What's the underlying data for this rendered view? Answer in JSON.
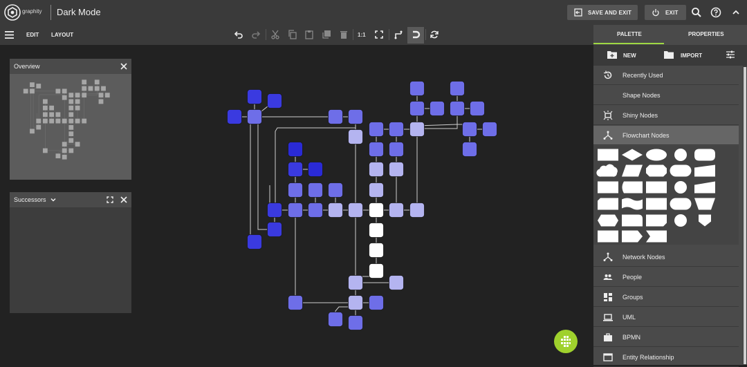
{
  "header": {
    "logo_text": "graphity",
    "app_title": "Dark Mode",
    "save_exit_label": "SAVE AND EXIT",
    "exit_label": "EXIT"
  },
  "toolbar": {
    "menu_edit": "EDIT",
    "menu_layout": "LAYOUT",
    "zoom_original_label": "1:1"
  },
  "overview_panel": {
    "title": "Overview"
  },
  "successors_panel": {
    "title": "Successors"
  },
  "right_panel": {
    "tabs": [
      {
        "label": "PALETTE",
        "active": true
      },
      {
        "label": "PROPERTIES",
        "active": false
      }
    ],
    "new_label": "NEW",
    "import_label": "IMPORT",
    "palette_items": [
      {
        "label": "Recently Used",
        "icon": "history-icon"
      },
      {
        "label": "Shape Nodes",
        "icon": "moon-icon"
      },
      {
        "label": "Shiny Nodes",
        "icon": "shiny-icon"
      },
      {
        "label": "Flowchart Nodes",
        "icon": "flowchart-icon",
        "selected": true
      },
      {
        "label": "Network Nodes",
        "icon": "network-icon"
      },
      {
        "label": "People",
        "icon": "people-icon"
      },
      {
        "label": "Groups",
        "icon": "groups-icon"
      },
      {
        "label": "UML",
        "icon": "laptop-icon"
      },
      {
        "label": "BPMN",
        "icon": "briefcase-icon"
      },
      {
        "label": "Entity Relationship",
        "icon": "window-icon"
      }
    ]
  },
  "colors": {
    "accent": "#9fd843",
    "node_dark": "#3a3ae0",
    "node_mid": "#6e6ee8",
    "node_light": "#b6b6f0",
    "node_white": "#ffffff",
    "edge": "#d0d0d0"
  }
}
